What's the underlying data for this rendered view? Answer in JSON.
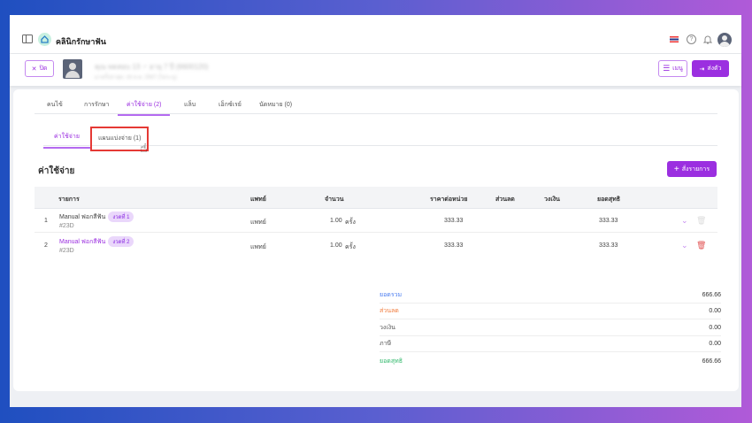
{
  "header": {
    "clinic_name": "คลินิกรักษาฟัน",
    "flag": "thai-flag-icon"
  },
  "patient": {
    "name": "คุณ ทดสอบ 13 ♂ อายุ 7 ปี (6600120)",
    "subtitle": "มาครั้งล่าสุด: 16 ส.ค. 2567 (ไม่ระบุ)",
    "close_label": "ปิด",
    "menu_label": "เมนู",
    "send_label": "ส่งตัว"
  },
  "tabs": [
    {
      "label": "คนไข้"
    },
    {
      "label": "การรักษา"
    },
    {
      "label": "ค่าใช้จ่าย (2)",
      "active": true
    },
    {
      "label": "แล็บ"
    },
    {
      "label": "เอ็กซ์เรย์"
    },
    {
      "label": "นัดหมาย (0)"
    }
  ],
  "subtabs": [
    {
      "label": "ค่าใช้จ่าย",
      "active": true
    },
    {
      "label": "แผนแบ่งจ่าย (1)",
      "highlighted": true
    }
  ],
  "section": {
    "title": "ค่าใช้จ่าย",
    "add_label": "สั่งรายการ"
  },
  "table": {
    "headers": [
      "รายการ",
      "แพทย์",
      "จำนวน",
      "ราคาต่อหน่วย",
      "ส่วนลด",
      "วงเงิน",
      "ยอดสุทธิ"
    ],
    "rows": [
      {
        "no": "1",
        "item": "Manual ฟอกสีฟัน",
        "badge": "งวดที่ 1",
        "code": "#23D",
        "doctor": "แพทย์",
        "qty": "1.00",
        "unit": "ครั้ง",
        "price": "333.33",
        "discount": "",
        "credit": "",
        "net": "333.33"
      },
      {
        "no": "2",
        "item": "Manual ฟอกสีฟัน",
        "badge": "งวดที่ 2",
        "code": "#23D",
        "doctor": "แพทย์",
        "qty": "1.00",
        "unit": "ครั้ง",
        "price": "333.33",
        "discount": "",
        "credit": "",
        "net": "333.33"
      }
    ]
  },
  "summary": [
    {
      "label": "ยอดรวม",
      "value": "666.66",
      "color": "#4a7cf0"
    },
    {
      "label": "ส่วนลด",
      "value": "0.00",
      "color": "#f07a3a"
    },
    {
      "label": "วงเงิน",
      "value": "0.00",
      "color": "#555555"
    },
    {
      "label": "ภาษี",
      "value": "0.00",
      "color": "#555555"
    },
    {
      "label": "ยอดสุทธิ",
      "value": "666.66",
      "color": "#2fb86a"
    }
  ],
  "colors": {
    "accent": "#9b2fe0",
    "highlight_box": "#e53935"
  }
}
